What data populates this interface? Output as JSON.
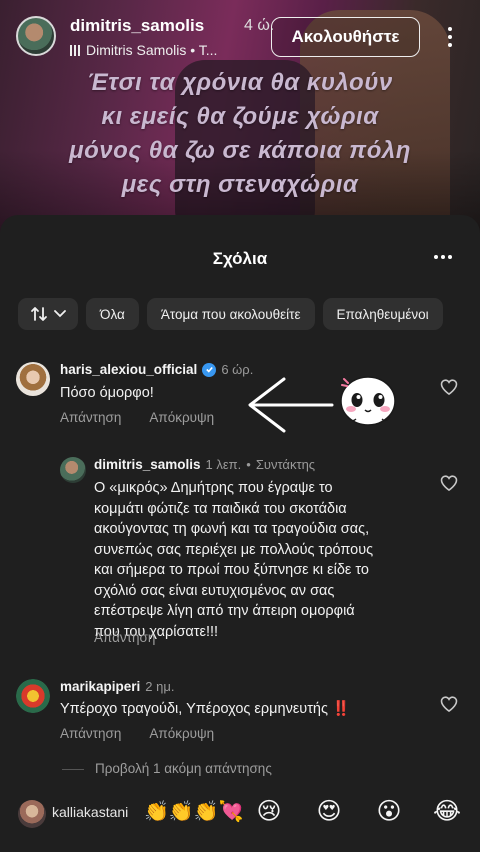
{
  "header": {
    "username": "dimitris_samolis",
    "time": "4 ώ.",
    "subtitle": "Dimitris Samolis • T...",
    "follow_label": "Ακολουθήστε"
  },
  "lyrics": [
    "Έτσι τα χρόνια θα κυλούν",
    "κι εμείς θα ζούμε χώρια",
    "μόνος θα ζω σε κάποια πόλη",
    "μες στη στεναχώρια"
  ],
  "sheet": {
    "title": "Σχόλια",
    "filters": [
      "Όλα",
      "Άτομα που ακολουθείτε",
      "Επαληθευμένοι"
    ]
  },
  "comments": [
    {
      "username": "haris_alexiou_official",
      "time": "6 ώρ.",
      "text": "Πόσο όμορφο!",
      "reply_label": "Απάντηση",
      "hide_label": "Απόκρυψη"
    },
    {
      "username": "dimitris_samolis",
      "time": "1 λεπ.",
      "role": "Συντάκτης",
      "text_lines": [
        "Ο «μικρός» Δημήτρης που έγραψε το",
        "κομμάτι φώτιζε τα παιδικά του σκοτάδια",
        "ακούγοντας τη φωνή και τα τραγούδια σας,",
        "συνεπώς σας περιέχει με πολλούς τρόπους",
        "και σήμερα το πρωί που ξύπνησε κι είδε το",
        "σχόλιό σας είναι ευτυχισμένος αν σας",
        "επέστρεψε λίγη από την άπειρη ομορφιά",
        "που του χαρίσατε!!!"
      ],
      "reply_label": "Απάντηση"
    },
    {
      "username": "marikapiperi",
      "time": "2 ημ.",
      "text": "Υπέροχο τραγούδι, Υπέροχος ερμηνευτής ‼️",
      "reply_label": "Απάντηση",
      "hide_label": "Απόκρυψη"
    }
  ],
  "view_more": "Προβολή 1 ακόμη απάντησης",
  "bottom": {
    "username": "kalliakastani",
    "inline_emojis": "👏👏👏💘",
    "quick_emojis": [
      "😢",
      "😍",
      "😮",
      "😂"
    ]
  },
  "icons": {
    "sort": "sort-arrows-icon",
    "heart": "heart-outline-icon",
    "more": "more-options-icon"
  }
}
